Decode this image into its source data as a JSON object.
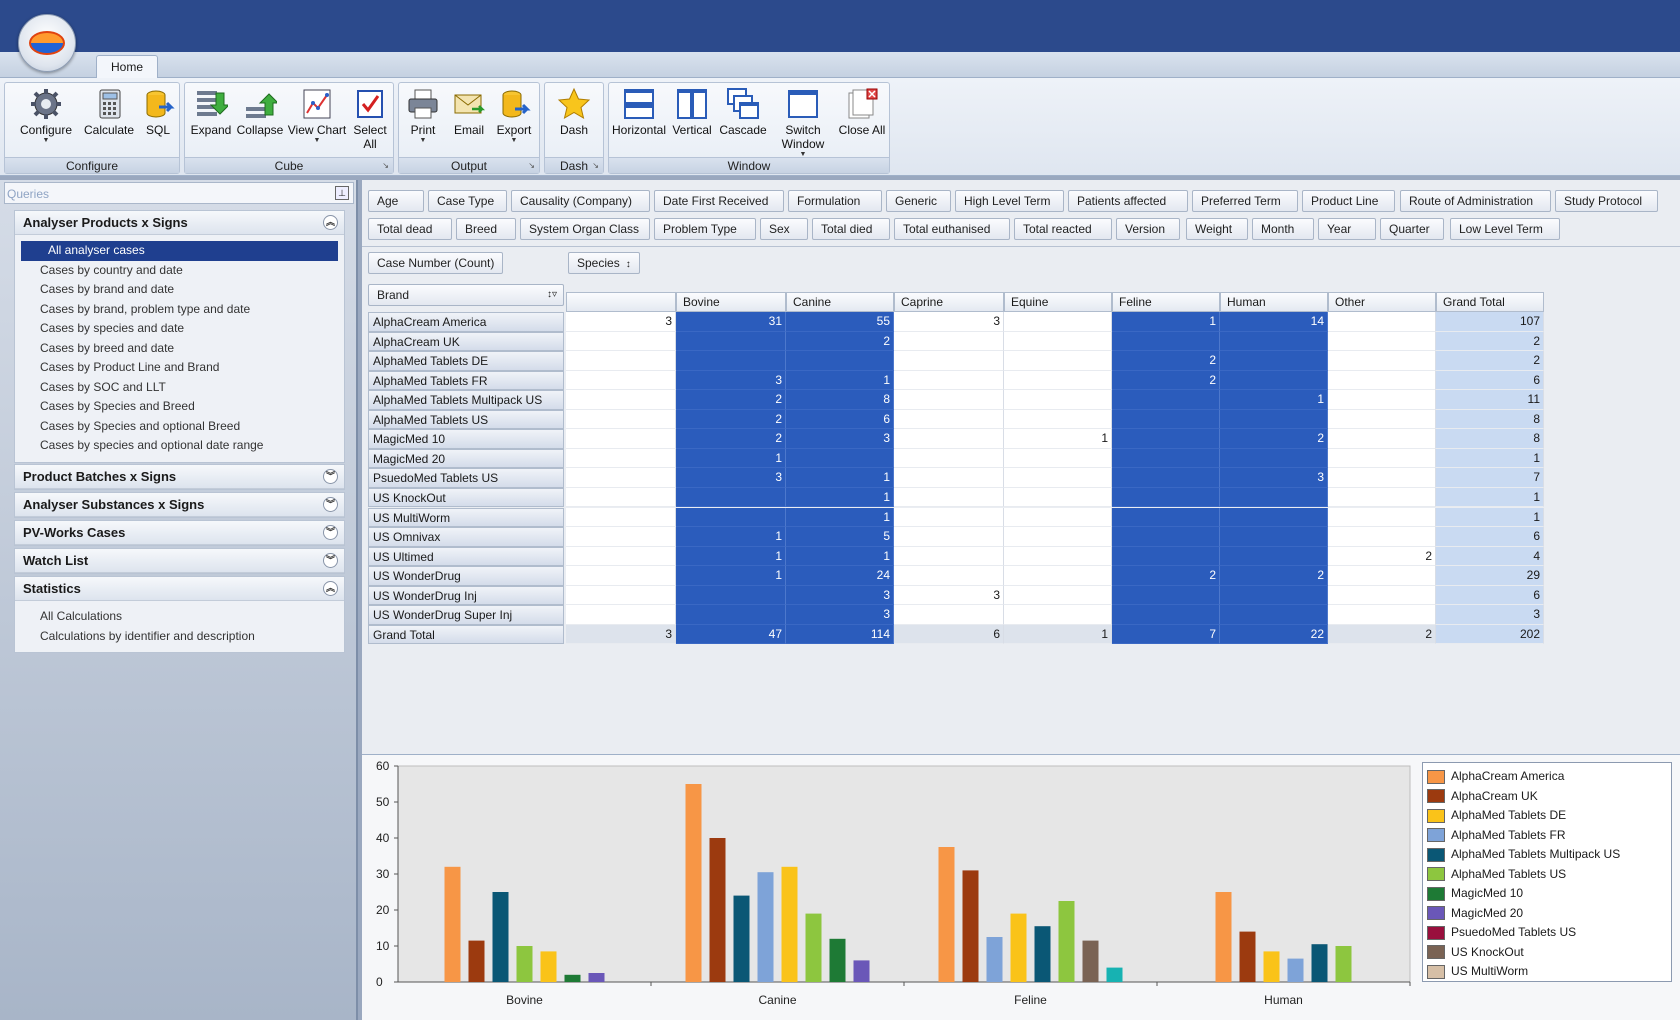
{
  "app": {
    "tab": "Home"
  },
  "ribbon": {
    "groups": [
      {
        "label": "Configure",
        "buttons": [
          "Configure",
          "Calculate",
          "SQL"
        ]
      },
      {
        "label": "Cube",
        "buttons": [
          "Expand",
          "Collapse",
          "View Chart",
          "Select All"
        ]
      },
      {
        "label": "Output",
        "buttons": [
          "Print",
          "Email",
          "Export"
        ]
      },
      {
        "label": "Dash",
        "buttons": [
          "Dash"
        ]
      },
      {
        "label": "Window",
        "buttons": [
          "Horizontal",
          "Vertical",
          "Cascade",
          "Switch Window",
          "Close All"
        ]
      }
    ]
  },
  "queries": {
    "placeholder": "Queries",
    "sections": [
      {
        "title": "Analyser Products x Signs",
        "expanded": true,
        "items": [
          "All analyser cases",
          "Cases by country and date",
          "Cases by brand and date",
          "Cases by brand, problem type and date",
          "Cases by species and date",
          "Cases by breed and date",
          "Cases by Product Line and Brand",
          "Cases by SOC and LLT",
          "Cases by Species and Breed",
          "Cases by Species and optional Breed",
          "Cases by species and optional date range"
        ]
      },
      {
        "title": "Product Batches x Signs",
        "expanded": false,
        "items": []
      },
      {
        "title": "Analyser Substances x Signs",
        "expanded": false,
        "items": []
      },
      {
        "title": "PV-Works Cases",
        "expanded": false,
        "items": []
      },
      {
        "title": "Watch List",
        "expanded": false,
        "items": []
      },
      {
        "title": "Statistics",
        "expanded": true,
        "items": [
          "All Calculations",
          "Calculations by identifier and description"
        ]
      }
    ]
  },
  "fields": {
    "row1": [
      "Age",
      "Case Type",
      "Causality (Company)",
      "Date First Received",
      "Formulation",
      "Generic",
      "High Level Term",
      "Patients affected",
      "Preferred Term",
      "Product Line",
      "Route of Administration",
      "Study Protocol"
    ],
    "row2": [
      "Total dead",
      "Breed",
      "System Organ Class",
      "Problem Type",
      "Sex",
      "Total died",
      "Total euthanised",
      "Total reacted",
      "Version",
      "Weight",
      "Month",
      "Year",
      "Quarter",
      "Low Level Term"
    ],
    "data_field": "Case Number (Count)",
    "column_field": "Species",
    "row_field": "Brand"
  },
  "grid": {
    "columns": [
      "",
      "Bovine",
      "Canine",
      "Caprine",
      "Equine",
      "Feline",
      "Human",
      "Other",
      "Grand Total"
    ],
    "rows": [
      {
        "label": "AlphaCream America",
        "values": [
          "3",
          "31",
          "55",
          "3",
          "",
          "1",
          "14",
          "",
          "107"
        ]
      },
      {
        "label": "AlphaCream UK",
        "values": [
          "",
          "",
          "2",
          "",
          "",
          "",
          "",
          "",
          "2"
        ]
      },
      {
        "label": "AlphaMed Tablets DE",
        "values": [
          "",
          "",
          "",
          "",
          "",
          "2",
          "",
          "",
          "2"
        ]
      },
      {
        "label": "AlphaMed Tablets FR",
        "values": [
          "",
          "3",
          "1",
          "",
          "",
          "2",
          "",
          "",
          "6"
        ]
      },
      {
        "label": "AlphaMed Tablets Multipack US",
        "values": [
          "",
          "2",
          "8",
          "",
          "",
          "",
          "1",
          "",
          "11"
        ]
      },
      {
        "label": "AlphaMed Tablets US",
        "values": [
          "",
          "2",
          "6",
          "",
          "",
          "",
          "",
          "",
          "8"
        ]
      },
      {
        "label": "MagicMed 10",
        "values": [
          "",
          "2",
          "3",
          "",
          "1",
          "",
          "2",
          "",
          "8"
        ]
      },
      {
        "label": "MagicMed 20",
        "values": [
          "",
          "1",
          "",
          "",
          "",
          "",
          "",
          "",
          "1"
        ]
      },
      {
        "label": "PsuedoMed Tablets US",
        "values": [
          "",
          "3",
          "1",
          "",
          "",
          "",
          "3",
          "",
          "7"
        ]
      },
      {
        "label": "US KnockOut",
        "values": [
          "",
          "",
          "1",
          "",
          "",
          "",
          "",
          "",
          "1"
        ]
      },
      {
        "label": "US MultiWorm",
        "values": [
          "",
          "",
          "1",
          "",
          "",
          "",
          "",
          "",
          "1"
        ]
      },
      {
        "label": "US Omnivax",
        "values": [
          "",
          "1",
          "5",
          "",
          "",
          "",
          "",
          "",
          "6"
        ]
      },
      {
        "label": "US Ultimed",
        "values": [
          "",
          "1",
          "1",
          "",
          "",
          "",
          "",
          "2",
          "4"
        ]
      },
      {
        "label": "US WonderDrug",
        "values": [
          "",
          "1",
          "24",
          "",
          "",
          "2",
          "2",
          "",
          "29"
        ]
      },
      {
        "label": "US WonderDrug Inj",
        "values": [
          "",
          "",
          "3",
          "3",
          "",
          "",
          "",
          "",
          "6"
        ]
      },
      {
        "label": "US WonderDrug Super Inj",
        "values": [
          "",
          "",
          "3",
          "",
          "",
          "",
          "",
          "",
          "3"
        ]
      },
      {
        "label": "Grand Total",
        "values": [
          "3",
          "47",
          "114",
          "6",
          "1",
          "7",
          "22",
          "2",
          "202"
        ]
      }
    ]
  },
  "chart_data": {
    "type": "bar",
    "categories": [
      "Bovine",
      "Canine",
      "Feline",
      "Human"
    ],
    "ylim": [
      0,
      60
    ],
    "yticks": [
      "0",
      "10",
      "20",
      "30",
      "40",
      "50",
      "60"
    ],
    "legend_position": "right",
    "series": [
      {
        "name": "AlphaCream America",
        "color": "#f79646",
        "values": [
          32,
          55,
          37.5,
          25
        ]
      },
      {
        "name": "AlphaCream UK",
        "color": "#9c3a0f",
        "values": [
          11.5,
          40,
          31,
          14
        ]
      },
      {
        "name": "AlphaMed Tablets DE",
        "color": "#fac319",
        "values": [
          null,
          null,
          null,
          null
        ]
      },
      {
        "name": "AlphaMed Tablets FR",
        "color": "#7ea3d8",
        "values": [
          null,
          null,
          12.5,
          6.5
        ]
      },
      {
        "name": "AlphaMed Tablets Multipack US",
        "color": "#0a5775",
        "values": [
          25,
          24,
          null,
          null
        ]
      },
      {
        "name": "AlphaMed Tablets US",
        "color": "#8dc63f",
        "values": [
          10,
          null,
          null,
          null
        ]
      },
      {
        "name": "MagicMed 10",
        "color": "#1e7a35",
        "values": [
          null,
          null,
          null,
          null
        ]
      },
      {
        "name": "MagicMed 20",
        "color": "#6a57b8",
        "values": [
          null,
          null,
          null,
          null
        ]
      },
      {
        "name": "PsuedoMed Tablets US",
        "color": "#990f3d",
        "values": [
          null,
          null,
          null,
          null
        ]
      },
      {
        "name": "US KnockOut",
        "color": "#7a6354",
        "values": [
          null,
          null,
          null,
          null
        ]
      },
      {
        "name": "US MultiWorm",
        "color": "#d6bfa6",
        "values": [
          null,
          null,
          null,
          null
        ]
      }
    ],
    "bars": [
      {
        "category": "Bovine",
        "values": [
          32,
          11.5,
          25,
          10,
          8.5,
          2,
          2.5
        ],
        "colors": [
          "#f79646",
          "#9c3a0f",
          "#0a5775",
          "#8dc63f",
          "#fac319",
          "#1e7a35",
          "#6a57b8"
        ]
      },
      {
        "category": "Canine",
        "values": [
          55,
          40,
          24,
          30.5,
          32,
          19,
          12,
          6
        ],
        "colors": [
          "#f79646",
          "#9c3a0f",
          "#0a5775",
          "#7ea3d8",
          "#fac319",
          "#8dc63f",
          "#1e7a35",
          "#6a57b8"
        ]
      },
      {
        "category": "Feline",
        "values": [
          37.5,
          31,
          12.5,
          19,
          15.5,
          22.5,
          11.5,
          4
        ],
        "colors": [
          "#f79646",
          "#9c3a0f",
          "#7ea3d8",
          "#fac319",
          "#0a5775",
          "#8dc63f",
          "#7a6354",
          "#17b2b2"
        ]
      },
      {
        "category": "Human",
        "values": [
          25,
          14,
          8.5,
          6.5,
          10.5,
          10
        ],
        "colors": [
          "#f79646",
          "#9c3a0f",
          "#fac319",
          "#7ea3d8",
          "#0a5775",
          "#8dc63f"
        ]
      }
    ]
  }
}
